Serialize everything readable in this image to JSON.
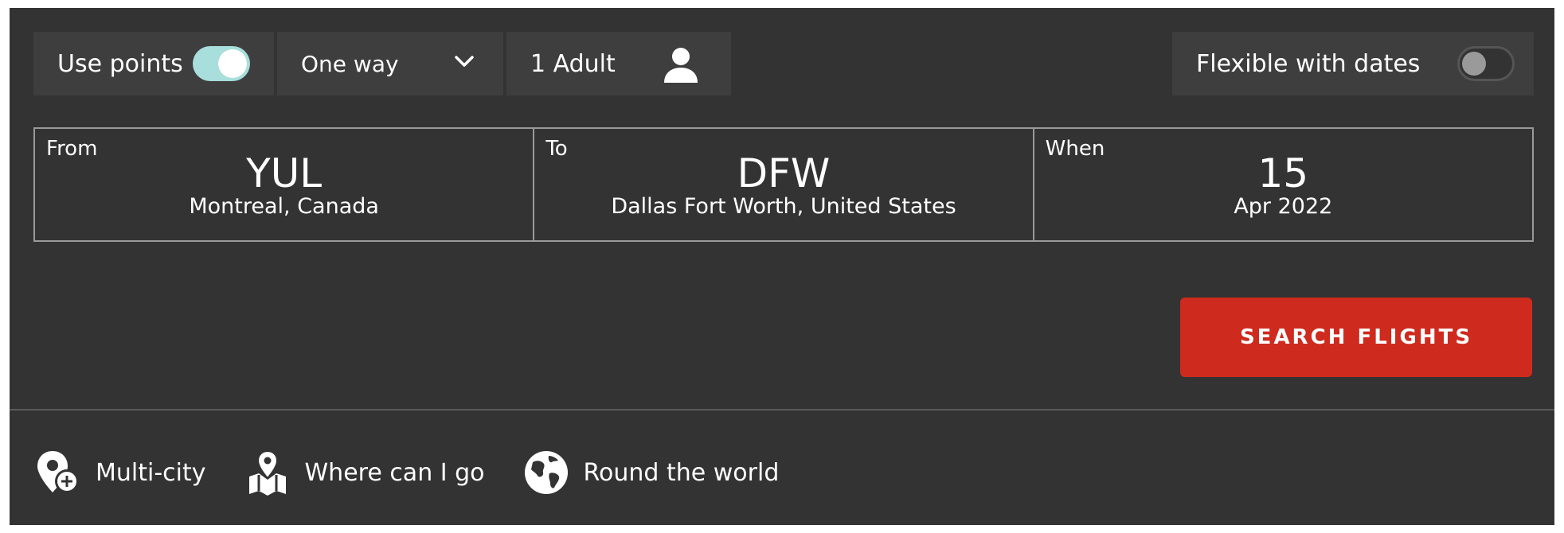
{
  "options": {
    "use_points_label": "Use points",
    "use_points_on": true,
    "trip_type": "One way",
    "passengers": "1 Adult",
    "flexible_label": "Flexible with dates",
    "flexible_on": false
  },
  "route": {
    "from": {
      "label": "From",
      "code": "YUL",
      "city": "Montreal, Canada"
    },
    "to": {
      "label": "To",
      "code": "DFW",
      "city": "Dallas Fort Worth, United States"
    },
    "when": {
      "label": "When",
      "day": "15",
      "month_year": "Apr 2022"
    }
  },
  "search_button": "SEARCH FLIGHTS",
  "links": [
    {
      "label": "Multi-city",
      "icon": "pin-plus-icon"
    },
    {
      "label": "Where can I go",
      "icon": "map-pin-icon"
    },
    {
      "label": "Round the world",
      "icon": "globe-icon"
    }
  ],
  "colors": {
    "panel": "#333333",
    "option_bg": "#3e3e3e",
    "toggle_on": "#a8dedc",
    "search_button": "#cf2a1e"
  }
}
